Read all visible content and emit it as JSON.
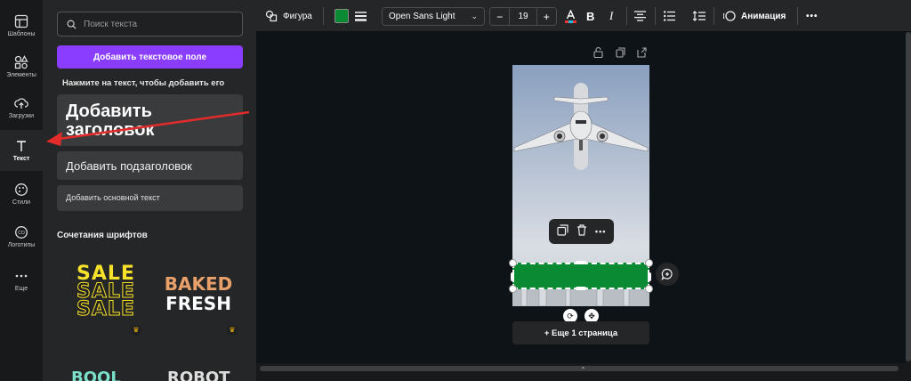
{
  "nav": {
    "items": [
      {
        "label": "Шаблоны",
        "icon": "templates-icon"
      },
      {
        "label": "Элементы",
        "icon": "elements-icon"
      },
      {
        "label": "Загрузки",
        "icon": "upload-icon"
      },
      {
        "label": "Текст",
        "icon": "text-icon"
      },
      {
        "label": "Стили",
        "icon": "styles-icon"
      },
      {
        "label": "Логотипы",
        "icon": "logo-icon"
      },
      {
        "label": "Еще",
        "icon": "more-icon"
      }
    ],
    "active": "Текст"
  },
  "panel": {
    "search_placeholder": "Поиск текста",
    "add_text_button": "Добавить текстовое поле",
    "hint": "Нажмите на текст, чтобы добавить его",
    "heading_card": "Добавить заголовок",
    "subheading_card": "Добавить подзаголовок",
    "body_card": "Добавить основной текст",
    "combos_title": "Сочетания шрифтов",
    "combos": [
      {
        "lines": [
          "SALE",
          "SALE",
          "SALE"
        ]
      },
      {
        "lines": [
          "BAKED",
          "FRESH"
        ]
      }
    ],
    "combos_row2": [
      "BOOL",
      "ROBOT"
    ]
  },
  "toolbar": {
    "shape_label": "Фигура",
    "fill_color": "#0a8a32",
    "font_name": "Open Sans Light",
    "font_size": "19",
    "minus": "−",
    "plus": "+",
    "bold": "B",
    "italic": "I",
    "animation": "Анимация",
    "more": "•••"
  },
  "canvas": {
    "more_pages": "+ Еще 1 страница",
    "ctx_more": "•••"
  },
  "colors": {
    "accent": "#8b3dff",
    "shape_fill": "#0a8a32",
    "arrow": "#e22b2b"
  }
}
